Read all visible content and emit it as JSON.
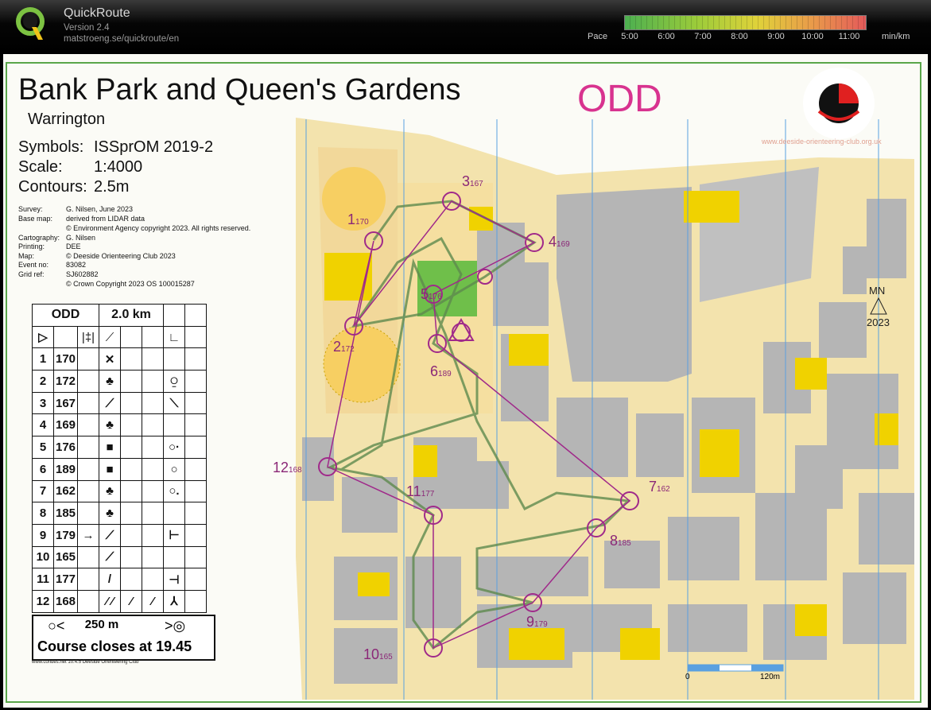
{
  "app": {
    "title": "QuickRoute",
    "version": "Version 2.4",
    "url": "matstroeng.se/quickroute/en"
  },
  "pace_scale": {
    "label": "Pace",
    "ticks": [
      "5:00",
      "6:00",
      "7:00",
      "8:00",
      "9:00",
      "10:00",
      "11:00"
    ],
    "unit": "min/km"
  },
  "map": {
    "title": "Bank Park and Queen's Gardens",
    "subtitle": "Warrington",
    "course": "ODD",
    "symbols_label": "Symbols:",
    "symbols_value": "ISSprOM 2019-2",
    "scale_label": "Scale:",
    "scale_value": "1:4000",
    "contours_label": "Contours:",
    "contours_value": "2.5m",
    "credits": [
      {
        "k": "Survey:",
        "v": "G. Nilsen, June 2023"
      },
      {
        "k": "Base map:",
        "v": "derived from LIDAR data"
      },
      {
        "k": "",
        "v": "© Environment Agency copyright 2023. All rights reserved."
      },
      {
        "k": "Cartography:",
        "v": "G. Nilsen"
      },
      {
        "k": "Printing:",
        "v": "DEE"
      },
      {
        "k": "Map:",
        "v": "© Deeside Orienteering Club 2023"
      },
      {
        "k": "Event no:",
        "v": "83082"
      },
      {
        "k": "Grid ref:",
        "v": "SJ602882"
      },
      {
        "k": "",
        "v": "© Crown Copyright 2023 OS 100015287"
      }
    ],
    "north_label": "MN",
    "north_year": "2023",
    "club_name": "DEESIDE ORIENTEERING CLUB",
    "club_url": "www.deeside-orienteering-club.org.uk",
    "scalebar_start": "0",
    "scalebar_end": "120m",
    "condes": "www.condes.net 10.4.5 Deeside Orienteering Club"
  },
  "descriptions": {
    "course": "ODD",
    "length": "2.0 km",
    "rows": [
      {
        "n": "1",
        "code": "170",
        "feature": "✕",
        "extra": ""
      },
      {
        "n": "2",
        "code": "172",
        "feature": "♣",
        "extra": "⍜"
      },
      {
        "n": "3",
        "code": "167",
        "feature": "⟋",
        "extra": "⟍"
      },
      {
        "n": "4",
        "code": "169",
        "feature": "♣",
        "extra": ""
      },
      {
        "n": "5",
        "code": "176",
        "feature": "■",
        "extra": "○·"
      },
      {
        "n": "6",
        "code": "189",
        "feature": "■",
        "extra": "○"
      },
      {
        "n": "7",
        "code": "162",
        "feature": "♣",
        "extra": "○."
      },
      {
        "n": "8",
        "code": "185",
        "feature": "♣",
        "extra": ""
      },
      {
        "n": "9",
        "code": "179",
        "feature": "⟋",
        "extra": "⊢",
        "arrow": "→"
      },
      {
        "n": "10",
        "code": "165",
        "feature": "⟋",
        "extra": ""
      },
      {
        "n": "11",
        "code": "177",
        "feature": "/",
        "extra": "⊣"
      },
      {
        "n": "12",
        "code": "168",
        "feature": "⁄ ⁄",
        "extra": ""
      }
    ],
    "scale_to_finish": "250 m",
    "closes": "Course closes at 19.45"
  },
  "controls": [
    {
      "n": "1",
      "code": "170"
    },
    {
      "n": "2",
      "code": "172"
    },
    {
      "n": "3",
      "code": "167"
    },
    {
      "n": "4",
      "code": "169"
    },
    {
      "n": "5",
      "code": "176"
    },
    {
      "n": "6",
      "code": "189"
    },
    {
      "n": "7",
      "code": "162"
    },
    {
      "n": "8",
      "code": "185"
    },
    {
      "n": "9",
      "code": "179"
    },
    {
      "n": "10",
      "code": "165"
    },
    {
      "n": "11",
      "code": "177"
    },
    {
      "n": "12",
      "code": "168"
    }
  ],
  "colors": {
    "control_purple": "#a0298a",
    "building": "#b5b5b5",
    "paved": "#f3e3ad",
    "vegetation_yellow": "#f0d200",
    "route_green": "#5e8a4e",
    "course_pink": "#d8338f"
  }
}
